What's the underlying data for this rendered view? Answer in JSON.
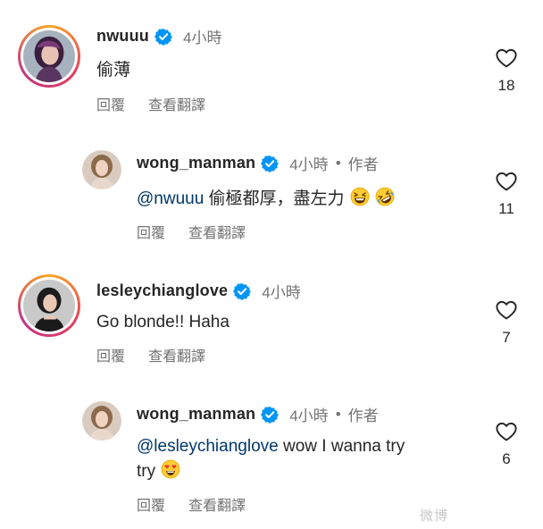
{
  "comments": [
    {
      "username": "nwuuu",
      "time": "4小時",
      "text": "偷薄",
      "reply_label": "回覆",
      "translate_label": "查看翻譯",
      "likes": "18"
    },
    {
      "username": "wong_manman",
      "time": "4小時",
      "dot": "•",
      "author_label": "作者",
      "mention": "@nwuuu",
      "text": " 偷極都厚，盡左力",
      "reply_label": "回覆",
      "translate_label": "查看翻譯",
      "likes": "11"
    },
    {
      "username": "lesleychianglove",
      "time": "4小時",
      "text": "Go blonde!! Haha",
      "reply_label": "回覆",
      "translate_label": "查看翻譯",
      "likes": "7"
    },
    {
      "username": "wong_manman",
      "time": "4小時",
      "dot": "•",
      "author_label": "作者",
      "mention": "@lesleychianglove",
      "text": " wow I wanna try",
      "text_line2": "try",
      "reply_label": "回覆",
      "translate_label": "查看翻譯",
      "likes": "6"
    }
  ],
  "icons": {
    "verified": "verified-badge-icon",
    "heart": "heart-outline-icon",
    "emoji_laugh": "grinning-squinting-face-icon",
    "emoji_rofl": "rolling-on-floor-laughing-icon",
    "emoji_hearts": "smiling-face-with-heart-eyes-icon"
  },
  "colors": {
    "verified_blue": "#0095f6",
    "mention": "#00376b",
    "meta_gray": "#737373"
  },
  "watermark": "微博"
}
